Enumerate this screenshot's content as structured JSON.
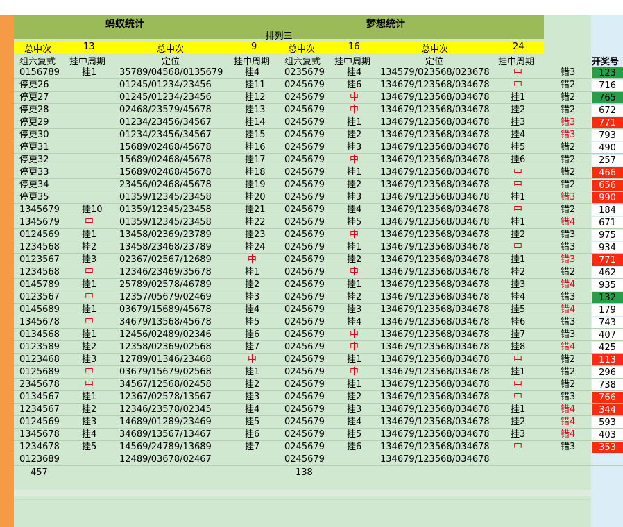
{
  "titles": {
    "left": "蚂蚁统计",
    "right": "梦想统计",
    "sub": "排列三"
  },
  "summary": {
    "left_label": "总中次",
    "left_value": "13",
    "center_label": "总中次",
    "center_value": "9",
    "right_label": "总中次",
    "right_value": "16",
    "far_label": "总中次",
    "far_value": "24"
  },
  "headers": {
    "c1": "组六复式",
    "c2": "挂中周期",
    "c3": "定位",
    "c4": "挂中周期",
    "c5": "组六复式",
    "c6": "挂中周期",
    "c7": "定位",
    "c8": "挂中周期",
    "kj": "开奖号"
  },
  "colors": {
    "orange": "#f59a45",
    "olive": "#9bbb59",
    "yellow": "#ffff00",
    "green_bg": "#cfe8cf",
    "hit_red": "#e0001b",
    "green_cell": "#23a049",
    "red_cell": "#ff2a10"
  },
  "rows": [
    {
      "a": "0156789",
      "b": "挂1",
      "d": "35789/04568/0135679",
      "e": "挂4",
      "f": "0235679",
      "g": "挂4",
      "h": "134579/023568/023678",
      "i": "中",
      "j": "错3",
      "k": "123",
      "kc": "green"
    },
    {
      "a": "停更26",
      "b": "",
      "d": "01245/01234/23456",
      "e": "挂11",
      "f": "0245679",
      "g": "挂6",
      "h": "134679/123568/034678",
      "i": "中",
      "j": "错2",
      "k": "716",
      "kc": "plain"
    },
    {
      "a": "停更27",
      "b": "",
      "d": "01245/01234/23456",
      "e": "挂12",
      "f": "0245679",
      "g": "中",
      "h": "134679/123568/034678",
      "i": "挂1",
      "j": "错2",
      "k": "765",
      "kc": "green"
    },
    {
      "a": "停更28",
      "b": "",
      "d": "02468/23579/45678",
      "e": "挂13",
      "f": "0245679",
      "g": "中",
      "h": "134679/123568/034678",
      "i": "挂2",
      "j": "错2",
      "k": "672",
      "kc": "plain"
    },
    {
      "a": "停更29",
      "b": "",
      "d": "01234/23456/34567",
      "e": "挂14",
      "f": "0245679",
      "g": "挂1",
      "h": "134679/123568/034678",
      "i": "挂3",
      "j": "错3",
      "k": "771",
      "kc": "red"
    },
    {
      "a": "停更30",
      "b": "",
      "d": "01234/23456/34567",
      "e": "挂15",
      "f": "0245679",
      "g": "挂2",
      "h": "134679/123568/034678",
      "i": "挂4",
      "j": "错3",
      "k": "793",
      "kc": "plain"
    },
    {
      "a": "停更31",
      "b": "",
      "d": "15689/02468/45678",
      "e": "挂16",
      "f": "0245679",
      "g": "挂3",
      "h": "134679/123568/034678",
      "i": "挂5",
      "j": "错2",
      "k": "490",
      "kc": "plain"
    },
    {
      "a": "停更32",
      "b": "",
      "d": "15689/02468/45678",
      "e": "挂17",
      "f": "0245679",
      "g": "中",
      "h": "134679/123568/034678",
      "i": "挂6",
      "j": "错2",
      "k": "257",
      "kc": "plain"
    },
    {
      "a": "停更33",
      "b": "",
      "d": "15689/02468/45678",
      "e": "挂18",
      "f": "0245679",
      "g": "挂1",
      "h": "134679/123568/034678",
      "i": "中",
      "j": "错2",
      "k": "466",
      "kc": "red"
    },
    {
      "a": "停更34",
      "b": "",
      "d": "23456/02468/45678",
      "e": "挂19",
      "f": "0245679",
      "g": "挂2",
      "h": "134679/123568/034678",
      "i": "中",
      "j": "错2",
      "k": "656",
      "kc": "red"
    },
    {
      "a": "停更35",
      "b": "",
      "d": "01359/12345/23458",
      "e": "挂20",
      "f": "0245679",
      "g": "挂3",
      "h": "134679/123568/034678",
      "i": "挂1",
      "j": "错3",
      "k": "990",
      "kc": "red"
    },
    {
      "a": "1345679",
      "b": "挂10",
      "d": "01359/12345/23458",
      "e": "挂21",
      "f": "0245679",
      "g": "挂4",
      "h": "134679/123568/034678",
      "i": "中",
      "j": "错2",
      "k": "184",
      "kc": "plain"
    },
    {
      "a": "1345679",
      "b": "中",
      "d": "01359/12345/23458",
      "e": "挂22",
      "f": "0245679",
      "g": "挂5",
      "h": "134679/123568/034678",
      "i": "挂1",
      "j": "错4",
      "k": "671",
      "kc": "plain"
    },
    {
      "a": "0124569",
      "b": "挂1",
      "d": "13458/02369/23789",
      "e": "挂23",
      "f": "0245679",
      "g": "中",
      "h": "134679/123568/034678",
      "i": "挂2",
      "j": "错3",
      "k": "975",
      "kc": "plain"
    },
    {
      "a": "1234568",
      "b": "挂2",
      "d": "13458/23468/23789",
      "e": "挂24",
      "f": "0245679",
      "g": "挂1",
      "h": "134679/123568/034678",
      "i": "中",
      "j": "错3",
      "k": "934",
      "kc": "plain"
    },
    {
      "a": "0123567",
      "b": "挂3",
      "d": "02367/02567/12689",
      "e": "中",
      "f": "0245679",
      "g": "挂2",
      "h": "134679/123568/034678",
      "i": "挂1",
      "j": "错3",
      "k": "771",
      "kc": "red"
    },
    {
      "a": "1234568",
      "b": "中",
      "d": "12346/23469/35678",
      "e": "挂1",
      "f": "0245679",
      "g": "中",
      "h": "134679/123568/034678",
      "i": "挂2",
      "j": "错2",
      "k": "462",
      "kc": "plain"
    },
    {
      "a": "0145789",
      "b": "挂1",
      "d": "25789/02578/46789",
      "e": "挂2",
      "f": "0245679",
      "g": "挂1",
      "h": "134679/123568/034678",
      "i": "挂3",
      "j": "错4",
      "k": "935",
      "kc": "plain"
    },
    {
      "a": "0123567",
      "b": "中",
      "d": "12357/05679/02469",
      "e": "挂3",
      "f": "0245679",
      "g": "挂2",
      "h": "134679/123568/034678",
      "i": "挂4",
      "j": "错3",
      "k": "132",
      "kc": "green"
    },
    {
      "a": "0145689",
      "b": "挂1",
      "d": "03679/15689/45678",
      "e": "挂4",
      "f": "0245679",
      "g": "挂3",
      "h": "134679/123568/034678",
      "i": "挂5",
      "j": "错4",
      "k": "179",
      "kc": "plain"
    },
    {
      "a": "1345678",
      "b": "中",
      "d": "34679/13568/45678",
      "e": "挂5",
      "f": "0245679",
      "g": "挂4",
      "h": "134679/123568/034678",
      "i": "挂6",
      "j": "错3",
      "k": "743",
      "kc": "plain"
    },
    {
      "a": "0134568",
      "b": "挂1",
      "d": "12456/02489/02346",
      "e": "挂6",
      "f": "0245679",
      "g": "中",
      "h": "134679/123568/034678",
      "i": "挂7",
      "j": "错3",
      "k": "407",
      "kc": "plain"
    },
    {
      "a": "0123589",
      "b": "挂2",
      "d": "12358/02369/02568",
      "e": "挂7",
      "f": "0245679",
      "g": "中",
      "h": "134679/123568/034678",
      "i": "挂8",
      "j": "错4",
      "k": "425",
      "kc": "plain"
    },
    {
      "a": "0123468",
      "b": "挂3",
      "d": "12789/01346/23468",
      "e": "中",
      "f": "0245679",
      "g": "挂1",
      "h": "134679/123568/034678",
      "i": "中",
      "j": "错2",
      "k": "113",
      "kc": "red"
    },
    {
      "a": "0125689",
      "b": "中",
      "d": "03679/15679/02568",
      "e": "挂1",
      "f": "0245679",
      "g": "中",
      "h": "134679/123568/034678",
      "i": "挂1",
      "j": "错2",
      "k": "296",
      "kc": "plain"
    },
    {
      "a": "2345678",
      "b": "中",
      "d": "34567/12568/02458",
      "e": "挂2",
      "f": "0245679",
      "g": "挂1",
      "h": "134679/123568/034678",
      "i": "中",
      "j": "错2",
      "k": "738",
      "kc": "plain"
    },
    {
      "a": "0134567",
      "b": "挂1",
      "d": "12367/02578/13567",
      "e": "挂3",
      "f": "0245679",
      "g": "挂2",
      "h": "134679/123568/034678",
      "i": "中",
      "j": "错3",
      "k": "766",
      "kc": "red"
    },
    {
      "a": "1234567",
      "b": "挂2",
      "d": "12346/23578/02345",
      "e": "挂4",
      "f": "0245679",
      "g": "挂3",
      "h": "134679/123568/034678",
      "i": "挂1",
      "j": "错4",
      "k": "344",
      "kc": "red"
    },
    {
      "a": "0124569",
      "b": "挂3",
      "d": "14689/01289/23469",
      "e": "挂5",
      "f": "0245679",
      "g": "挂4",
      "h": "134679/123568/034678",
      "i": "挂2",
      "j": "错4",
      "k": "593",
      "kc": "plain"
    },
    {
      "a": "1345678",
      "b": "挂4",
      "d": "34689/13567/13467",
      "e": "挂6",
      "f": "0245679",
      "g": "挂5",
      "h": "134679/123568/034678",
      "i": "挂3",
      "j": "错4",
      "k": "403",
      "kc": "plain"
    },
    {
      "a": "1234678",
      "b": "挂5",
      "d": "14569/24789/13689",
      "e": "挂7",
      "f": "0245679",
      "g": "挂6",
      "h": "134679/123568/034678",
      "i": "中",
      "j": "错3",
      "k": "353",
      "kc": "red"
    },
    {
      "a": "0123689",
      "b": "",
      "d": "12489/03678/02467",
      "e": "",
      "f": "0245679",
      "g": "",
      "h": "134679/123568/034678",
      "i": "",
      "j": "",
      "k": "",
      "kc": "none"
    }
  ],
  "footer": {
    "left_total": "457",
    "right_total": "138"
  }
}
